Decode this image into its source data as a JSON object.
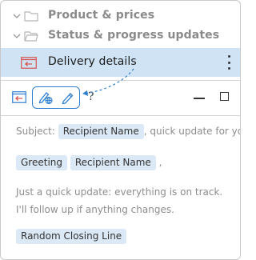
{
  "tree": {
    "items": [
      {
        "label": "Product & prices"
      },
      {
        "label": "Status & progress updates"
      }
    ],
    "selected": {
      "label": "Delivery details"
    }
  },
  "toolbar": {
    "help_label": "?"
  },
  "template": {
    "subject_prefix": "Subject:",
    "subject_chip": "Recipient Name",
    "subject_suffix": ", quick update for you",
    "greeting_chip": "Greeting",
    "recipient_chip": "Recipient Name",
    "greeting_suffix": ",",
    "body_line_1": "Just a quick update: everything is on track.",
    "body_line_2": "I'll follow up if anything changes.",
    "closing_chip": "Random Closing Line"
  },
  "colors": {
    "accent": "#2f7fd0",
    "selected_bg": "#cfe3f5",
    "chip_bg": "#dbe8f6",
    "folder_icon": "#b5b5b5",
    "item_icon_red": "#d9534f"
  },
  "icons": {
    "tree_chevron": "chevron-down-icon",
    "tree_folder": "folder-icon",
    "selected_item": "template-arrow-icon",
    "toolbar_insert": "insert-template-icon",
    "toolbar_edit_globe": "edit-globe-icon",
    "toolbar_edit": "pencil-icon",
    "more": "more-vertical-icon"
  }
}
